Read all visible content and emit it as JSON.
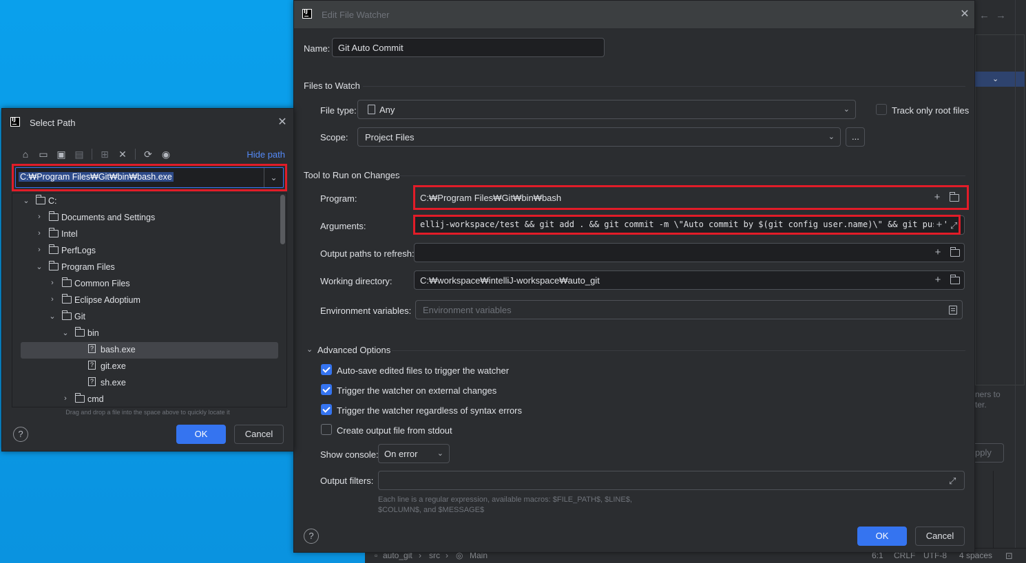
{
  "select_path": {
    "title": "Select Path",
    "hide_path": "Hide path",
    "path_value": "C:₩Program Files₩Git₩bin₩bash.exe",
    "tree": [
      {
        "label": "C:",
        "type": "folder",
        "depth": 0,
        "expanded": true
      },
      {
        "label": "Documents and Settings",
        "type": "link-folder",
        "depth": 1,
        "expanded": false
      },
      {
        "label": "Intel",
        "type": "folder",
        "depth": 1,
        "expanded": false
      },
      {
        "label": "PerfLogs",
        "type": "folder",
        "depth": 1,
        "expanded": false
      },
      {
        "label": "Program Files",
        "type": "folder",
        "depth": 1,
        "expanded": true
      },
      {
        "label": "Common Files",
        "type": "folder",
        "depth": 2,
        "expanded": false
      },
      {
        "label": "Eclipse Adoptium",
        "type": "folder",
        "depth": 2,
        "expanded": false
      },
      {
        "label": "Git",
        "type": "folder",
        "depth": 2,
        "expanded": true
      },
      {
        "label": "bin",
        "type": "folder",
        "depth": 3,
        "expanded": true
      },
      {
        "label": "bash.exe",
        "type": "file",
        "depth": 4,
        "selected": true
      },
      {
        "label": "git.exe",
        "type": "file",
        "depth": 4
      },
      {
        "label": "sh.exe",
        "type": "file",
        "depth": 4
      },
      {
        "label": "cmd",
        "type": "folder",
        "depth": 3,
        "expanded": false
      }
    ],
    "drag_hint": "Drag and drop a file into the space above to quickly locate it",
    "ok": "OK",
    "cancel": "Cancel"
  },
  "file_watcher": {
    "title": "Edit File Watcher",
    "name_label": "Name:",
    "name_value": "Git Auto Commit",
    "files_to_watch": "Files to Watch",
    "file_type_label": "File type:",
    "file_type_value": "Any",
    "track_root_label": "Track only root files",
    "scope_label": "Scope:",
    "scope_value": "Project Files",
    "scope_more": "...",
    "tool_section": "Tool to Run on Changes",
    "program_label": "Program:",
    "program_value": "C:₩Program Files₩Git₩bin₩bash",
    "arguments_label": "Arguments:",
    "arguments_value": "ellij-workspace/test && git add . && git commit -m \\\"Auto commit by $(git config user.name)\\\" && git push\"",
    "output_paths_label": "Output paths to refresh:",
    "output_paths_value": "",
    "working_dir_label": "Working directory:",
    "working_dir_value": "C:₩workspace₩intelliJ-workspace₩auto_git",
    "env_label": "Environment variables:",
    "env_placeholder": "Environment variables",
    "advanced": "Advanced Options",
    "options": [
      {
        "label": "Auto-save edited files to trigger the watcher",
        "checked": true
      },
      {
        "label": "Trigger the watcher on external changes",
        "checked": true
      },
      {
        "label": "Trigger the watcher regardless of syntax errors",
        "checked": true
      },
      {
        "label": "Create output file from stdout",
        "checked": false
      }
    ],
    "show_console_label": "Show console:",
    "show_console_value": "On error",
    "output_filters_label": "Output filters:",
    "filters_hint_1": "Each line is a regular expression, available macros: $FILE_PATH$, $LINE$,",
    "filters_hint_2": "$COLUMN$, and $MESSAGE$",
    "ok": "OK",
    "cancel": "Cancel"
  },
  "background": {
    "side_text_1": "ners to",
    "side_text_2": "ter.",
    "apply": "pply",
    "status": {
      "breadcrumb_project": "auto_git",
      "breadcrumb_src": "src",
      "breadcrumb_main": "Main",
      "position": "6:1",
      "line_sep": "CRLF",
      "encoding": "UTF-8",
      "indent": "4 spaces"
    }
  },
  "colors": {
    "accent": "#3574f0",
    "highlight_box": "#e21c28",
    "dialog_bg": "#2b2d30",
    "desktop": "#0a98e6"
  }
}
